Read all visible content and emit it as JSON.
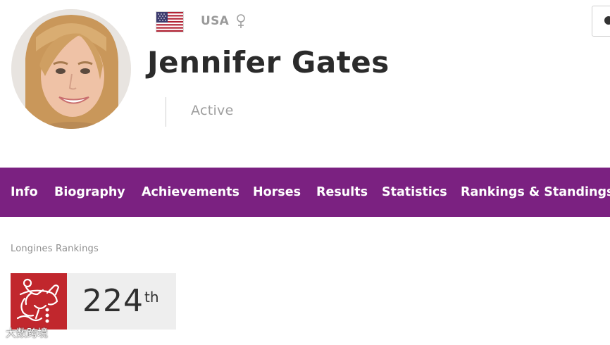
{
  "header": {
    "country": "USA",
    "athlete_name": "Jennifer Gates",
    "status": "Active",
    "gender_icon": "female-symbol-icon",
    "flag_icon": "usa-flag-icon"
  },
  "nav": {
    "items": [
      {
        "label": "Info"
      },
      {
        "label": "Biography"
      },
      {
        "label": "Achievements"
      },
      {
        "label": "Horses"
      },
      {
        "label": "Results"
      },
      {
        "label": "Statistics"
      },
      {
        "label": "Rankings & Standings"
      }
    ],
    "background": "#7b2181"
  },
  "rankings": {
    "section_label": "Longines Rankings",
    "rank": "224",
    "rank_suffix": "th",
    "discipline_icon": "show-jumping-icon",
    "icon_color": "#c1272d"
  },
  "watermark": {
    "text": "大数跨境"
  }
}
